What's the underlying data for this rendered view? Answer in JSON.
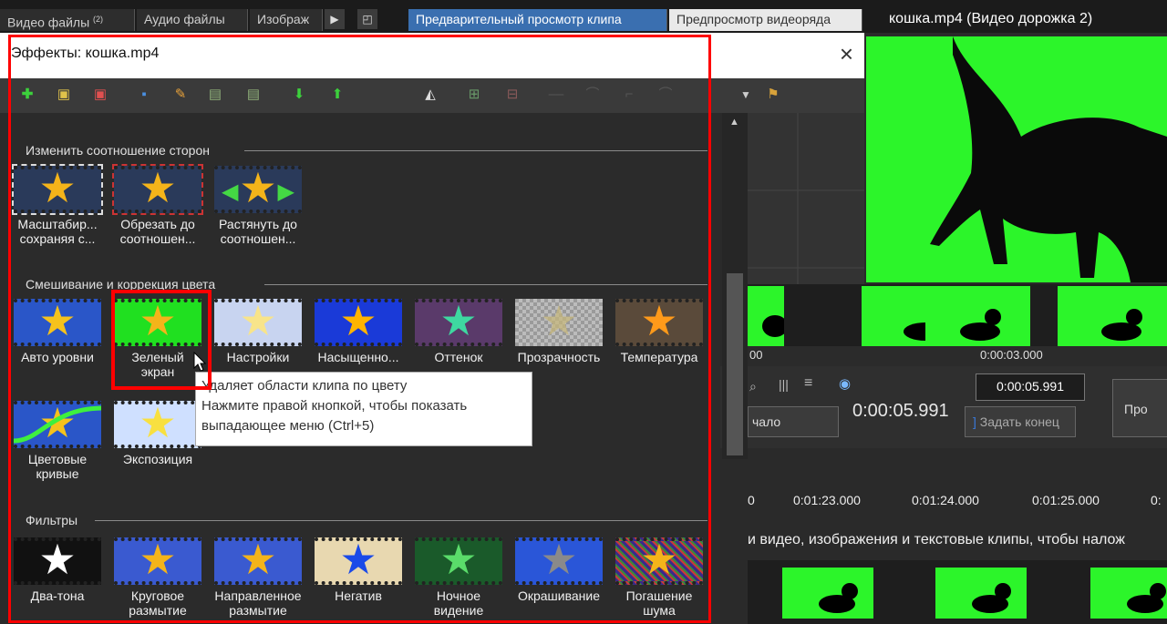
{
  "tabs": [
    {
      "label": "Видео файлы",
      "badge": "(2)"
    },
    {
      "label": "Аудио файлы"
    },
    {
      "label": "Изображ"
    },
    {
      "label": "Предварительный просмотр клипа"
    },
    {
      "label": "Предпросмотр видеоряда"
    }
  ],
  "preview_title": "кошка.mp4 (Видео дорожка 2)",
  "dialog": {
    "title": "Эффекты: кошка.mp4",
    "close_glyph": "×"
  },
  "sections": {
    "aspect": "Изменить соотношение сторон",
    "color": "Смешивание и коррекция цвета",
    "filters": "Фильтры"
  },
  "aspect_effects": [
    {
      "line1": "Масштабир...",
      "line2": "сохраняя с..."
    },
    {
      "line1": "Обрезать до",
      "line2": "соотношен..."
    },
    {
      "line1": "Растянуть до",
      "line2": "соотношен..."
    }
  ],
  "color_effects": [
    {
      "line1": "Авто уровни",
      "line2": ""
    },
    {
      "line1": "Зеленый",
      "line2": "экран"
    },
    {
      "line1": "Настройки",
      "line2": ""
    },
    {
      "line1": "Насыщенно...",
      "line2": ""
    },
    {
      "line1": "Оттенок",
      "line2": ""
    },
    {
      "line1": "Прозрачность",
      "line2": ""
    },
    {
      "line1": "Температура",
      "line2": ""
    },
    {
      "line1": "Цветовые",
      "line2": "кривые"
    },
    {
      "line1": "Экспозиция",
      "line2": ""
    }
  ],
  "filter_effects": [
    {
      "line1": "Два-тона",
      "line2": ""
    },
    {
      "line1": "Круговое",
      "line2": "размытие"
    },
    {
      "line1": "Направленное",
      "line2": "размытие"
    },
    {
      "line1": "Негатив",
      "line2": ""
    },
    {
      "line1": "Ночное",
      "line2": "видение"
    },
    {
      "line1": "Окрашивание",
      "line2": ""
    },
    {
      "line1": "Погашение",
      "line2": "шума"
    }
  ],
  "tooltip": {
    "line1": "Удаляет области клипа по цвету",
    "line2": "Нажмите правой кнопкой, чтобы показать",
    "line3": "выпадающее меню (Ctrl+5)"
  },
  "controls": {
    "ruler_time_a": "00",
    "ruler_time_b": "0:00:03.000",
    "position_time": "0:00:05.991",
    "end_time": "0:00:05.991",
    "start_btn": "чало",
    "set_end_btn": "Задать конец",
    "right_btn": "Про"
  },
  "timeline": {
    "ticks": [
      "0",
      "0:01:23.000",
      "0:01:24.000",
      "0:01:25.000",
      "0:"
    ],
    "hint": "и видео, изображения и текстовые клипы, чтобы налож"
  },
  "colors": {
    "green_screen": "#2cf52a",
    "highlight": "#ff0000",
    "tab_active": "#3a6fb0"
  }
}
